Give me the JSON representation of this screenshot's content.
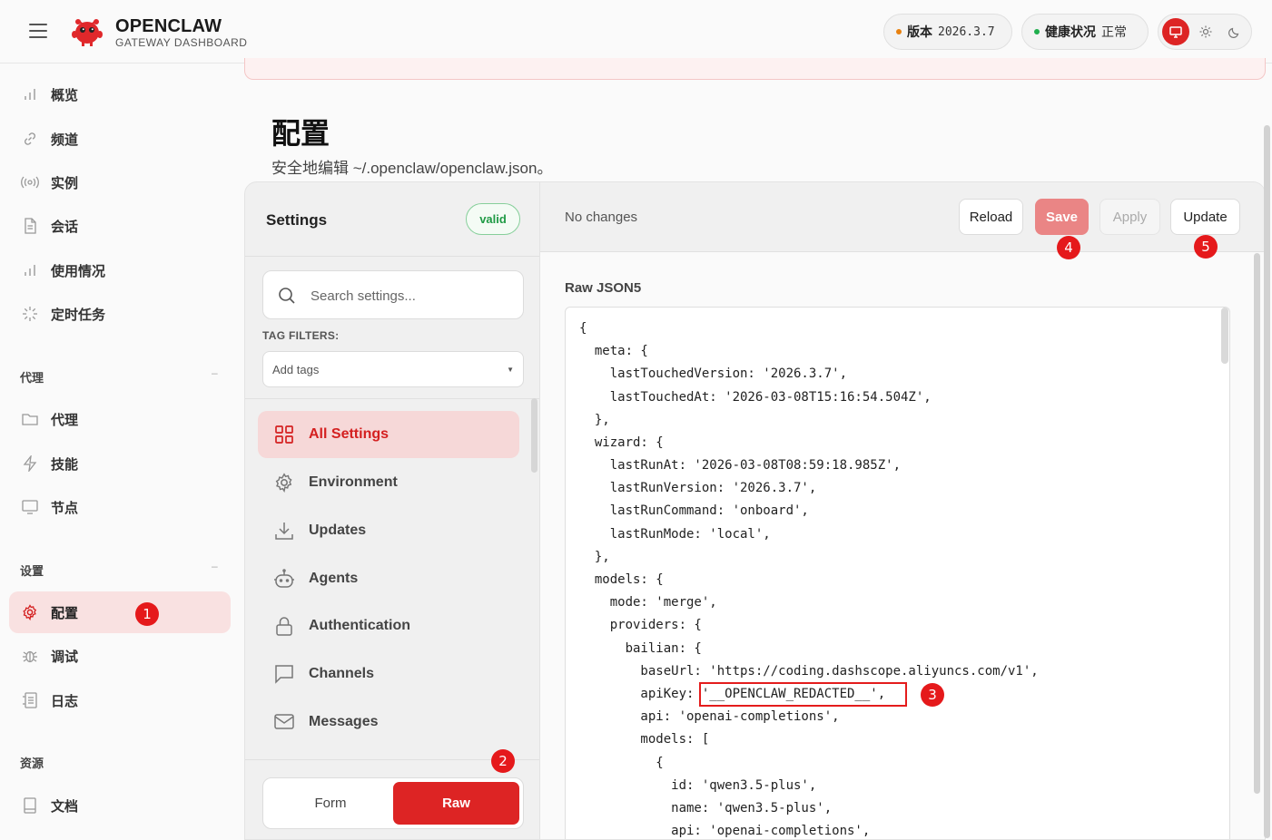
{
  "brand": {
    "title": "OPENCLAW",
    "subtitle": "GATEWAY DASHBOARD"
  },
  "status": {
    "version_label": "版本",
    "version_value": "2026.3.7",
    "version_dot_color": "#e8810f",
    "health_label": "健康状况",
    "health_value": "正常",
    "health_dot_color": "#1fae4d"
  },
  "nav": {
    "main": [
      {
        "label": "概览",
        "icon": "bar-chart-icon"
      },
      {
        "label": "频道",
        "icon": "link-icon"
      },
      {
        "label": "实例",
        "icon": "radio-icon"
      },
      {
        "label": "会话",
        "icon": "document-icon"
      },
      {
        "label": "使用情况",
        "icon": "bar-chart-icon"
      },
      {
        "label": "定时任务",
        "icon": "loader-icon"
      }
    ],
    "agent_group": {
      "title": "代理",
      "collapse": "–",
      "items": [
        {
          "label": "代理",
          "icon": "folder-icon"
        },
        {
          "label": "技能",
          "icon": "bolt-icon"
        },
        {
          "label": "节点",
          "icon": "monitor-icon"
        }
      ]
    },
    "settings_group": {
      "title": "设置",
      "collapse": "–",
      "items": [
        {
          "label": "配置",
          "icon": "gear-icon",
          "active": true
        },
        {
          "label": "调试",
          "icon": "bug-icon"
        },
        {
          "label": "日志",
          "icon": "log-icon"
        }
      ]
    },
    "resources_group": {
      "title": "资源",
      "items": [
        {
          "label": "文档",
          "icon": "book-icon"
        }
      ]
    }
  },
  "page": {
    "title": "配置",
    "subtitle": "安全地编辑 ~/.openclaw/openclaw.json。"
  },
  "settings": {
    "title": "Settings",
    "valid_badge": "valid",
    "search_placeholder": "Search settings...",
    "tag_filters_label": "TAG FILTERS:",
    "add_tags": "Add tags",
    "sections": [
      {
        "label": "All Settings",
        "icon": "grid-icon",
        "active": true
      },
      {
        "label": "Environment",
        "icon": "gear-icon"
      },
      {
        "label": "Updates",
        "icon": "download-icon"
      },
      {
        "label": "Agents",
        "icon": "robot-icon"
      },
      {
        "label": "Authentication",
        "icon": "lock-icon"
      },
      {
        "label": "Channels",
        "icon": "chat-icon"
      },
      {
        "label": "Messages",
        "icon": "mail-icon"
      }
    ],
    "mode_form": "Form",
    "mode_raw": "Raw"
  },
  "editor": {
    "status": "No changes",
    "buttons": {
      "reload": "Reload",
      "save": "Save",
      "apply": "Apply",
      "update": "Update"
    },
    "raw_label": "Raw JSON5",
    "lines": [
      "{",
      "  meta: {",
      "    lastTouchedVersion: '2026.3.7',",
      "    lastTouchedAt: '2026-03-08T15:16:54.504Z',",
      "  },",
      "  wizard: {",
      "    lastRunAt: '2026-03-08T08:59:18.985Z',",
      "    lastRunVersion: '2026.3.7',",
      "    lastRunCommand: 'onboard',",
      "    lastRunMode: 'local',",
      "  },",
      "  models: {",
      "    mode: 'merge',",
      "    providers: {",
      "      bailian: {",
      "        baseUrl: 'https://coding.dashscope.aliyuncs.com/v1',",
      "        apiKey: '__OPENCLAW_REDACTED__',",
      "        api: 'openai-completions',",
      "        models: [",
      "          {",
      "            id: 'qwen3.5-plus',",
      "            name: 'qwen3.5-plus',",
      "            api: 'openai-completions',"
    ]
  },
  "annotations": {
    "b1": "1",
    "b2": "2",
    "b3": "3",
    "b4": "4",
    "b5": "5"
  }
}
